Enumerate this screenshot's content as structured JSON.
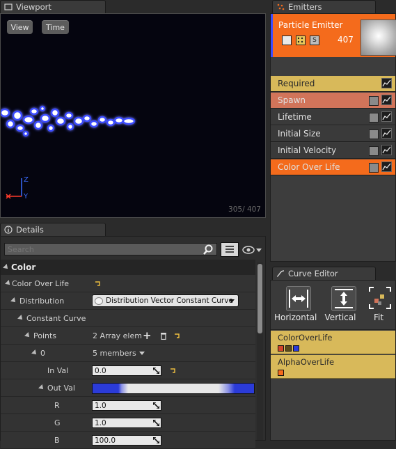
{
  "viewport": {
    "tab_label": "Viewport",
    "view_button": "View",
    "time_button": "Time",
    "particle_count": "305/ 407",
    "axis_z": "Z",
    "axis_y": "Y"
  },
  "emitters": {
    "tab_label": "Emitters",
    "emitter_name": "Particle Emitter",
    "emitter_count": "407",
    "modules": [
      {
        "label": "Required",
        "color": "#d8b95a",
        "has_check": false
      },
      {
        "label": "Spawn",
        "color": "#d1745a",
        "has_check": true
      },
      {
        "label": "Lifetime",
        "color": "#3a3a3a",
        "has_check": true
      },
      {
        "label": "Initial Size",
        "color": "#3a3a3a",
        "has_check": true
      },
      {
        "label": "Initial Velocity",
        "color": "#3a3a3a",
        "has_check": true
      },
      {
        "label": "Color Over Life",
        "color": "#f46b1c",
        "has_check": true
      }
    ]
  },
  "details": {
    "tab_label": "Details",
    "search_placeholder": "Search",
    "section_title": "Color",
    "rows": {
      "color_over_life": "Color Over Life",
      "distribution": "Distribution",
      "distribution_value": "Distribution Vector Constant Curve",
      "constant_curve": "Constant Curve",
      "points": "Points",
      "points_value": "2 Array elem",
      "index_0": "0",
      "index_0_value": "5 members",
      "in_val": "In Val",
      "in_val_value": "0.0",
      "out_val": "Out Val",
      "r": "R",
      "r_value": "1.0",
      "g": "G",
      "g_value": "1.0",
      "b": "B",
      "b_value": "100.0"
    }
  },
  "curve_editor": {
    "tab_label": "Curve Editor",
    "buttons": {
      "horizontal": "Horizontal",
      "vertical": "Vertical",
      "fit": "Fit"
    },
    "tracks": [
      {
        "label": "ColorOverLife"
      },
      {
        "label": "AlphaOverLife"
      }
    ]
  },
  "colors": {
    "accent_orange": "#f46b1c",
    "required_gold": "#d8b95a",
    "spawn_salmon": "#d1745a",
    "particle_blue": "#3b4cff"
  }
}
